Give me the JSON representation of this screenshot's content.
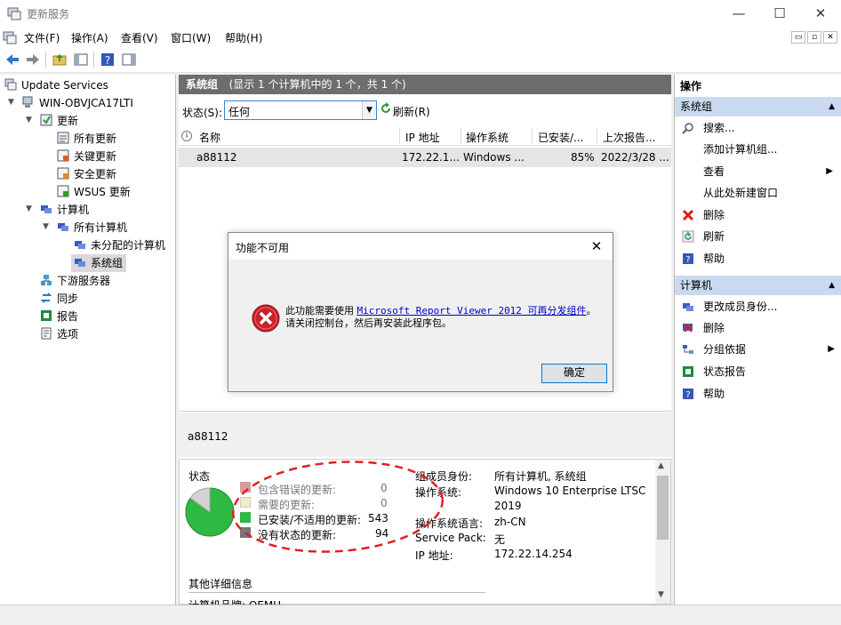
{
  "window": {
    "title": "更新服务",
    "minimize": "—",
    "maximize": "☐",
    "close": "✕"
  },
  "menu": [
    "文件(F)",
    "操作(A)",
    "查看(V)",
    "窗口(W)",
    "帮助(H)"
  ],
  "mdi_buttons": [
    "▭",
    "▫",
    "✕"
  ],
  "tree": {
    "root": "Update Services",
    "server": "WIN-OBVJCA17LTI",
    "updates": "更新",
    "all_updates": "所有更新",
    "critical": "关键更新",
    "security": "安全更新",
    "wsus": "WSUS 更新",
    "computers": "计算机",
    "all_computers": "所有计算机",
    "unassigned": "未分配的计算机",
    "group": "系统组",
    "downstream": "下游服务器",
    "sync": "同步",
    "reports": "报告",
    "options": "选项"
  },
  "center": {
    "header_title": "系统组",
    "header_sub": "(显示 1 个计算机中的 1 个，共 1 个)",
    "status_label": "状态(S):",
    "status_value": "任何",
    "refresh": "刷新(R)",
    "columns": [
      "名称",
      "IP 地址",
      "操作系统",
      "已安装/...",
      "上次报告..."
    ],
    "row": {
      "name": "a88112",
      "ip": "172.22.1...",
      "os": "Windows ...",
      "pct": "85%",
      "last": "2022/3/28 ..."
    },
    "detail_name": "a88112"
  },
  "details": {
    "status_label": "状态",
    "pie": {
      "installed_fraction": 0.85,
      "colors": {
        "installed": "#2fb844",
        "no_status": "#d4d4d4"
      }
    },
    "legend": [
      {
        "label": "包含错误的更新:",
        "value": "0",
        "color": "#d99a9a"
      },
      {
        "label": "需要的更新:",
        "value": "0",
        "color": "#f4ecc2"
      },
      {
        "label": "已安装/不适用的更新:",
        "value": "543",
        "color": "#2fb844"
      },
      {
        "label": "没有状态的更新:",
        "value": "94",
        "color": "#777777"
      }
    ],
    "props": [
      {
        "k": "组成员身份:",
        "v": "所有计算机, 系统组"
      },
      {
        "k": "操作系统:",
        "v": "Windows 10 Enterprise LTSC"
      },
      {
        "k": "",
        "v": "2019"
      },
      {
        "k": "操作系统语言:",
        "v": "zh-CN"
      },
      {
        "k": "Service Pack:",
        "v": "无"
      },
      {
        "k": "IP 地址:",
        "v": "172.22.14.254"
      }
    ],
    "more_title": "其他详细信息",
    "more_cut": "计算机品牌: QEMU"
  },
  "actions": {
    "title": "操作",
    "section1": "系统组",
    "items1": [
      "搜索...",
      "添加计算机组...",
      "查看",
      "从此处新建窗口",
      "删除",
      "刷新",
      "帮助"
    ],
    "section2": "计算机",
    "items2": [
      "更改成员身份...",
      "删除",
      "分组依据",
      "状态报告",
      "帮助"
    ]
  },
  "dialog": {
    "title": "功能不可用",
    "msg_prefix": "此功能需要使用 ",
    "link": "Microsoft Report Viewer 2012 可再分发组件",
    "msg_suffix": "。",
    "msg_line2": "请关闭控制台，然后再安装此程序包。",
    "ok": "确定"
  }
}
